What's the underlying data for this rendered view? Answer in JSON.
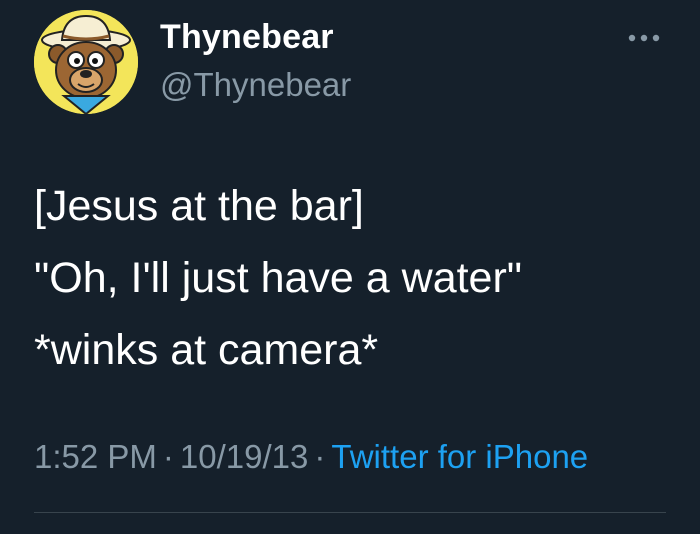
{
  "tweet": {
    "author": {
      "display_name": "Thynebear",
      "handle": "@Thynebear",
      "avatar_icon": "cartoon-bear-cowboy-avatar"
    },
    "more_icon": "more-horizontal-icon",
    "text_lines": [
      "[Jesus at the bar]",
      "\"Oh, I'll just have a water\"",
      "*winks at camera*"
    ],
    "time": "1:52 PM",
    "date": "10/19/13",
    "separator": "·",
    "source": "Twitter for iPhone"
  },
  "colors": {
    "background": "#15202b",
    "text_primary": "#ffffff",
    "text_secondary": "#8899a6",
    "link": "#1da1f2",
    "divider": "#38444d"
  }
}
